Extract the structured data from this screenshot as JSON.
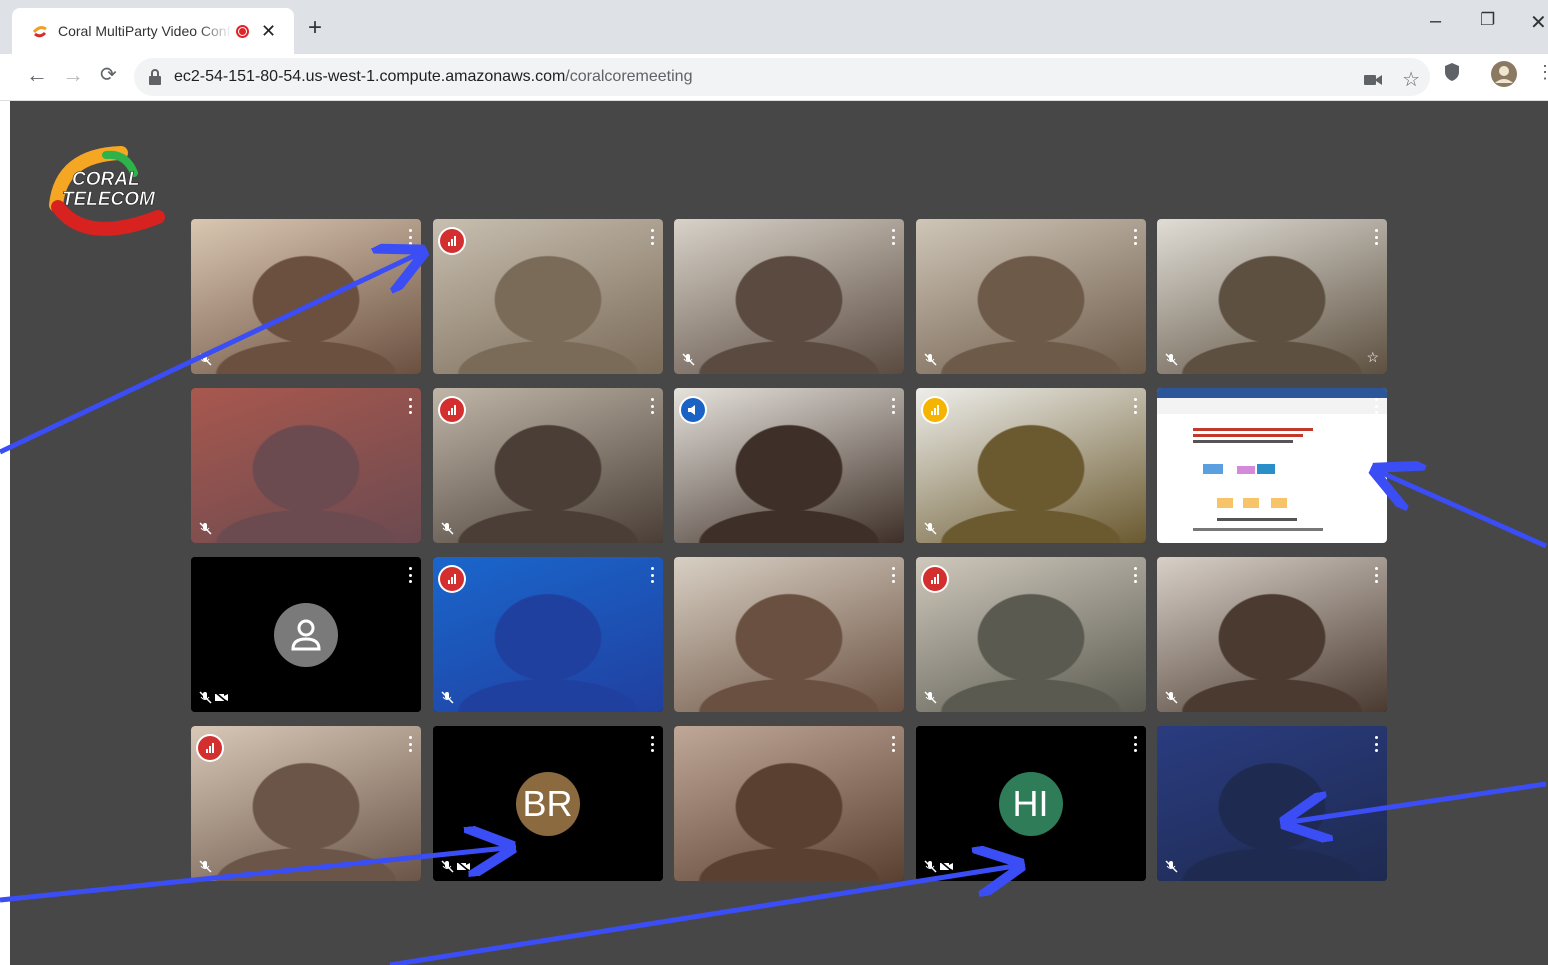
{
  "browser": {
    "tab_title": "Coral MultiParty Video Conference",
    "url_host": "ec2-54-151-80-54.us-west-1.compute.amazonaws.com",
    "url_path": "/coralcoremeeting",
    "window_controls": [
      "minimize-icon",
      "restore-icon",
      "close-icon"
    ]
  },
  "app": {
    "logo_text_line1": "CORAL",
    "logo_text_line2": "TELECOM",
    "colors": {
      "background": "#474747",
      "active_speaker_border": "#1f5fbf",
      "badge_red": "#d32f2f",
      "badge_blue": "#1a63c4",
      "badge_yellow": "#f5b400",
      "avatar_brown": "#8b6a40",
      "avatar_green": "#2e7d58"
    }
  },
  "participants": [
    {
      "badge": null,
      "mic_off": true,
      "cam_off": false
    },
    {
      "badge": "red",
      "mic_off": false,
      "cam_off": false
    },
    {
      "badge": null,
      "mic_off": true,
      "cam_off": false
    },
    {
      "badge": null,
      "mic_off": true,
      "cam_off": false
    },
    {
      "badge": null,
      "mic_off": true,
      "cam_off": false,
      "pinned_star": true
    },
    {
      "badge": null,
      "mic_off": true,
      "cam_off": false
    },
    {
      "badge": "red",
      "mic_off": true,
      "cam_off": false
    },
    {
      "badge": "blue",
      "mic_off": false,
      "cam_off": false,
      "active_speaker": true
    },
    {
      "badge": "yellow",
      "mic_off": true,
      "cam_off": false
    },
    {
      "badge": null,
      "mic_off": false,
      "cam_off": false,
      "screen_share": true
    },
    {
      "badge": null,
      "mic_off": true,
      "cam_off": true,
      "avatar": "person-icon"
    },
    {
      "badge": "red",
      "mic_off": true,
      "cam_off": false
    },
    {
      "badge": null,
      "mic_off": false,
      "cam_off": false
    },
    {
      "badge": "red",
      "mic_off": true,
      "cam_off": false
    },
    {
      "badge": null,
      "mic_off": true,
      "cam_off": false
    },
    {
      "badge": "red",
      "mic_off": true,
      "cam_off": false
    },
    {
      "badge": null,
      "mic_off": true,
      "cam_off": true,
      "initials": "BR"
    },
    {
      "badge": null,
      "mic_off": false,
      "cam_off": false
    },
    {
      "badge": null,
      "mic_off": true,
      "cam_off": true,
      "initials": "HI"
    },
    {
      "badge": null,
      "mic_off": true,
      "cam_off": false
    }
  ]
}
